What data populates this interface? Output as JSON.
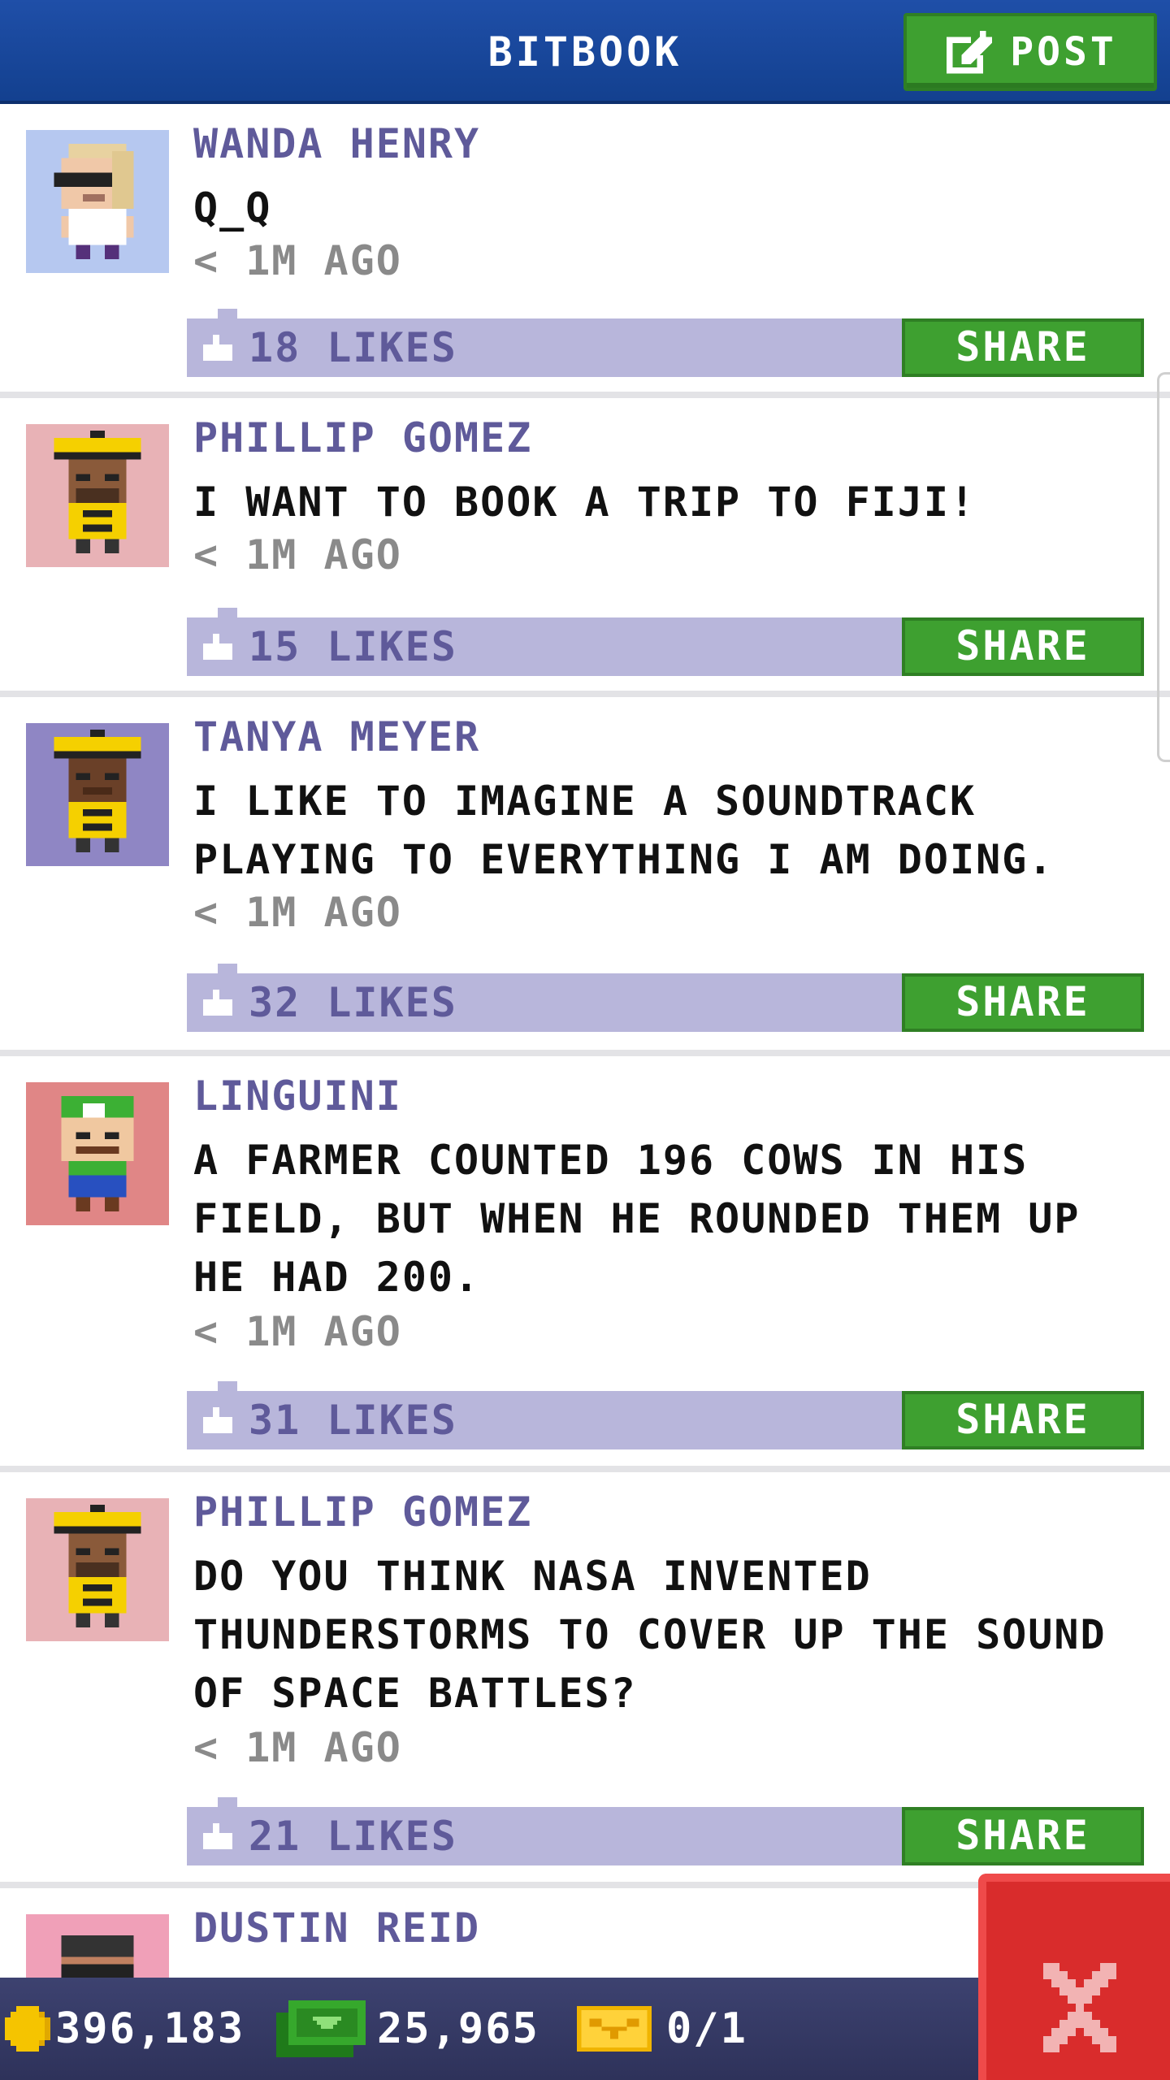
{
  "header": {
    "title": "BITBOOK",
    "post_label": "POST"
  },
  "posts": [
    {
      "name": "WANDA HENRY",
      "text": "Q_Q",
      "time": "< 1M AGO",
      "likes": "18 LIKES",
      "share": "SHARE",
      "avatar_bg": "#b6c8f0"
    },
    {
      "name": "PHILLIP GOMEZ",
      "text": "I WANT TO BOOK A TRIP TO FIJI!",
      "time": "< 1M AGO",
      "likes": "15 LIKES",
      "share": "SHARE",
      "avatar_bg": "#e8b2b6"
    },
    {
      "name": "TANYA MEYER",
      "text": "I LIKE TO IMAGINE A SOUNDTRACK PLAYING TO EVERYTHING I AM DOING.",
      "time": "< 1M AGO",
      "likes": "32 LIKES",
      "share": "SHARE",
      "avatar_bg": "#8f86c4"
    },
    {
      "name": "LINGUINI",
      "text": "A FARMER COUNTED 196 COWS IN HIS FIELD, BUT WHEN HE ROUNDED THEM UP HE HAD 200.",
      "time": "< 1M AGO",
      "likes": "31 LIKES",
      "share": "SHARE",
      "avatar_bg": "#e08686"
    },
    {
      "name": "PHILLIP GOMEZ",
      "text": "DO YOU THINK NASA INVENTED THUNDERSTORMS TO COVER UP THE SOUND OF SPACE BATTLES?",
      "time": "< 1M AGO",
      "likes": "21 LIKES",
      "share": "SHARE",
      "avatar_bg": "#e8b2b6"
    },
    {
      "name": "DUSTIN REID",
      "avatar_bg": "#f0a0b8"
    }
  ],
  "footer": {
    "coins": "396,183",
    "bux": "25,965",
    "tickets": "0/1"
  },
  "colors": {
    "header": "#1a4a9f",
    "accent_green": "#3ea030",
    "likes_bar": "#b8b6db",
    "name_purple": "#5f5a9a",
    "close_red": "#d92c2c",
    "footer": "#363a66"
  },
  "icons": {
    "post": "edit-icon",
    "like": "thumbs-up-icon",
    "coin": "coin-icon",
    "bux": "cash-icon",
    "ticket": "ticket-icon",
    "close": "close-icon"
  }
}
